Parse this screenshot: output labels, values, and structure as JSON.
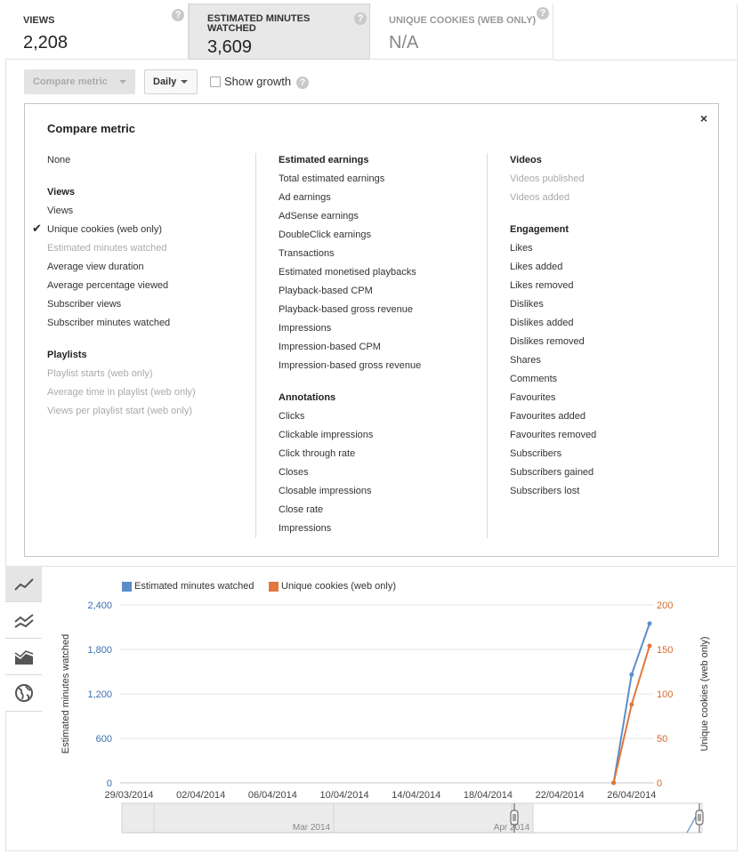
{
  "metrics": [
    {
      "label": "VIEWS",
      "value": "2,208"
    },
    {
      "label": "ESTIMATED MINUTES WATCHED",
      "value": "3,609"
    },
    {
      "label": "UNIQUE COOKIES (WEB ONLY)",
      "value": "N/A"
    }
  ],
  "toolbar": {
    "compare_label": "Compare metric",
    "period_label": "Daily",
    "show_growth_label": "Show growth",
    "help_glyph": "?"
  },
  "dialog": {
    "title": "Compare metric",
    "close_glyph": "×",
    "check_glyph": "✔",
    "col1": [
      {
        "text": "None"
      },
      {
        "spacer": true
      },
      {
        "text": "Views",
        "heading": true
      },
      {
        "text": "Views"
      },
      {
        "text": "Unique cookies (web only)",
        "checked": true
      },
      {
        "text": "Estimated minutes watched",
        "disabled": true
      },
      {
        "text": "Average view duration"
      },
      {
        "text": "Average percentage viewed"
      },
      {
        "text": "Subscriber views"
      },
      {
        "text": "Subscriber minutes watched"
      },
      {
        "spacer": true
      },
      {
        "text": "Playlists",
        "heading": true
      },
      {
        "text": "Playlist starts (web only)",
        "disabled": true
      },
      {
        "text": "Average time in playlist (web only)",
        "disabled": true
      },
      {
        "text": "Views per playlist start (web only)",
        "disabled": true
      }
    ],
    "col2": [
      {
        "text": "Estimated earnings",
        "heading": true
      },
      {
        "text": "Total estimated earnings"
      },
      {
        "text": "Ad earnings"
      },
      {
        "text": "AdSense earnings"
      },
      {
        "text": "DoubleClick earnings"
      },
      {
        "text": "Transactions"
      },
      {
        "text": "Estimated monetised playbacks"
      },
      {
        "text": "Playback-based CPM"
      },
      {
        "text": "Playback-based gross revenue"
      },
      {
        "text": "Impressions"
      },
      {
        "text": "Impression-based CPM"
      },
      {
        "text": "Impression-based gross revenue"
      },
      {
        "spacer": true
      },
      {
        "text": "Annotations",
        "heading": true
      },
      {
        "text": "Clicks"
      },
      {
        "text": "Clickable impressions"
      },
      {
        "text": "Click through rate"
      },
      {
        "text": "Closes"
      },
      {
        "text": "Closable impressions"
      },
      {
        "text": "Close rate"
      },
      {
        "text": "Impressions"
      }
    ],
    "col3": [
      {
        "text": "Videos",
        "heading": true
      },
      {
        "text": "Videos published",
        "disabled": true
      },
      {
        "text": "Videos added",
        "disabled": true
      },
      {
        "spacer": true
      },
      {
        "text": "Engagement",
        "heading": true
      },
      {
        "text": "Likes"
      },
      {
        "text": "Likes added"
      },
      {
        "text": "Likes removed"
      },
      {
        "text": "Dislikes"
      },
      {
        "text": "Dislikes added"
      },
      {
        "text": "Dislikes removed"
      },
      {
        "text": "Shares"
      },
      {
        "text": "Comments"
      },
      {
        "text": "Favourites"
      },
      {
        "text": "Favourites added"
      },
      {
        "text": "Favourites removed"
      },
      {
        "text": "Subscribers"
      },
      {
        "text": "Subscribers gained"
      },
      {
        "text": "Subscribers lost"
      }
    ]
  },
  "chart_sidebar": [
    {
      "icon": "line-chart-icon",
      "active": true
    },
    {
      "icon": "multiline-chart-icon",
      "active": false
    },
    {
      "icon": "area-chart-icon",
      "active": false
    },
    {
      "icon": "globe-icon",
      "active": false
    }
  ],
  "chart_data": {
    "type": "line",
    "x_tick_labels": [
      "29/03/2014",
      "02/04/2014",
      "06/04/2014",
      "10/04/2014",
      "14/04/2014",
      "18/04/2014",
      "22/04/2014",
      "26/04/2014"
    ],
    "x_range": [
      "29/03/2014",
      "27/04/2014"
    ],
    "ylabel_left": "Estimated minutes watched",
    "ylabel_right": "Unique cookies (web only)",
    "y_left_ticks": [
      "0",
      "600",
      "1,200",
      "1,800",
      "2,400"
    ],
    "y_right_ticks": [
      "0",
      "50",
      "100",
      "150",
      "200"
    ],
    "y_left_range": [
      0,
      2400
    ],
    "y_right_range": [
      0,
      200
    ],
    "grid": true,
    "legend_position": "top-left",
    "series": [
      {
        "name": "Estimated minutes watched",
        "axis": "left",
        "color": "#5b8dc9",
        "points": [
          {
            "x": "25/04/2014",
            "y": 0
          },
          {
            "x": "26/04/2014",
            "y": 1460
          },
          {
            "x": "27/04/2014",
            "y": 2150
          }
        ]
      },
      {
        "name": "Unique cookies (web only)",
        "axis": "right",
        "color": "#e0773b",
        "points": [
          {
            "x": "25/04/2014",
            "y": 0
          },
          {
            "x": "26/04/2014",
            "y": 88
          },
          {
            "x": "27/04/2014",
            "y": 154
          }
        ]
      }
    ]
  },
  "navigator": {
    "labels": [
      "Mar 2014",
      "Apr 2014"
    ]
  },
  "colors": {
    "left_axis": "#3c6fb0",
    "right_axis": "#d4682c",
    "grid": "#e6e6e6"
  }
}
